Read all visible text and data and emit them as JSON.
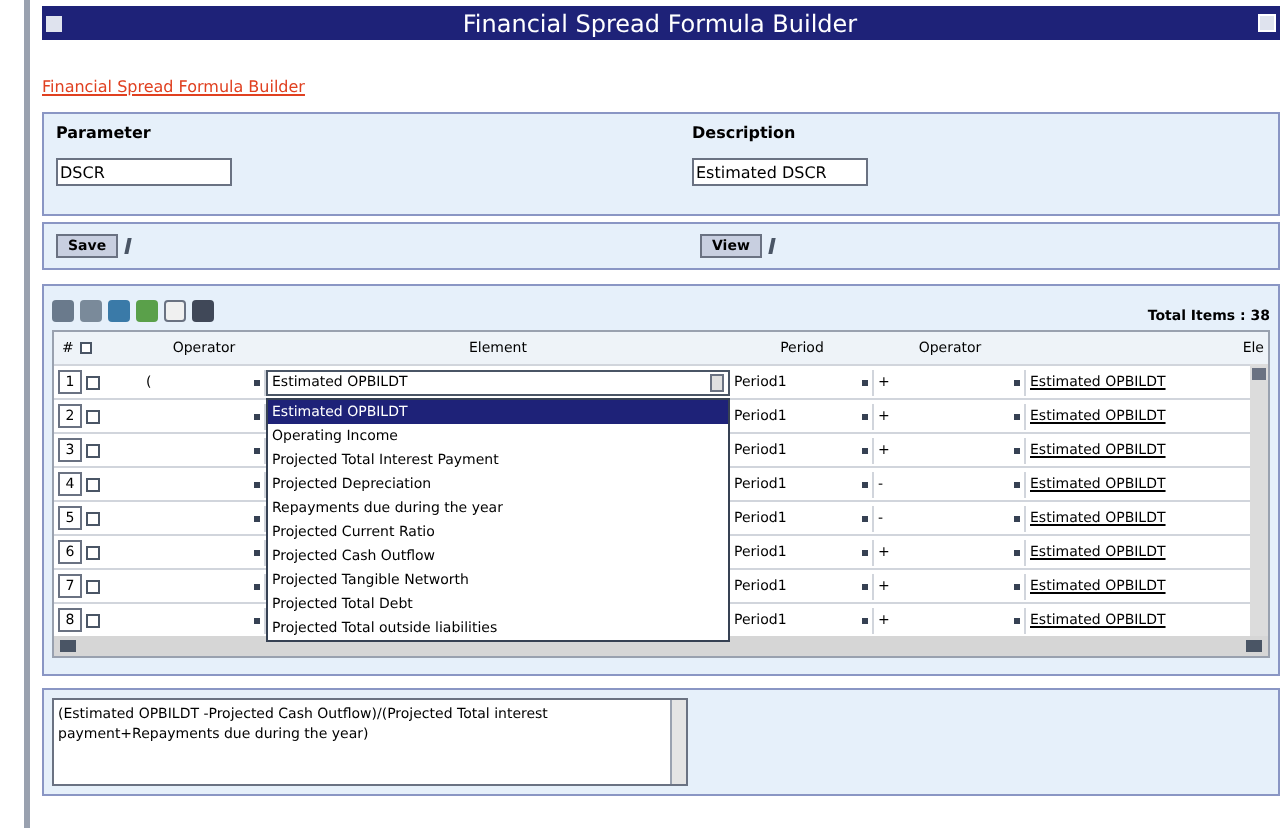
{
  "window": {
    "title": "Financial Spread Formula Builder"
  },
  "breadcrumb": "Financial Spread Formula Builder",
  "parameter": {
    "label": "Parameter",
    "value": "DSCR"
  },
  "description": {
    "label": "Description",
    "value": "Estimated DSCR"
  },
  "buttons": [
    {
      "label": "Save"
    },
    {
      "label": "View"
    }
  ],
  "grid": {
    "total": "Total Items : 38",
    "columns": [
      "#",
      "Operator",
      "Element",
      "Period",
      "Operator",
      "Ele"
    ],
    "select_all_checked": false,
    "rows": [
      {
        "number": "1",
        "checked": false,
        "operator": "(",
        "element": "Estimated OPBILDT",
        "period": "Period1",
        "operator_2": "+",
        "element_2": "Estimated OPBILDT"
      },
      {
        "number": "2",
        "checked": false,
        "period": "Period1",
        "operator_2": "+",
        "element_2": "Estimated OPBILDT"
      },
      {
        "number": "3",
        "checked": false,
        "period": "Period1",
        "operator_2": "+",
        "element_2": "Estimated OPBILDT"
      },
      {
        "number": "4",
        "checked": false,
        "period": "Period1",
        "operator_2": "-",
        "element_2": "Estimated OPBILDT"
      },
      {
        "number": "5",
        "checked": false,
        "period": "Period1",
        "operator_2": "-",
        "element_2": "Estimated OPBILDT"
      },
      {
        "number": "6",
        "checked": false,
        "period": "Period1",
        "operator_2": "+",
        "element_2": "Estimated OPBILDT"
      },
      {
        "number": "7",
        "checked": false,
        "period": "Period1",
        "operator_2": "+",
        "element_2": "Estimated OPBILDT"
      },
      {
        "number": "8",
        "checked": false,
        "period": "Period1",
        "operator_2": "+",
        "element_2": "Estimated OPBILDT"
      }
    ],
    "dropdown": [
      {
        "label": "Estimated OPBILDT",
        "selected": true
      },
      {
        "label": "Operating Income",
        "selected": false
      },
      {
        "label": "Projected Total Interest Payment",
        "selected": false
      },
      {
        "label": "Projected Depreciation",
        "selected": false
      },
      {
        "label": "Repayments due during the year",
        "selected": false
      },
      {
        "label": "Projected Current Ratio",
        "selected": false
      },
      {
        "label": "Projected Cash Outflow",
        "selected": false
      },
      {
        "label": "Projected Tangible Networth",
        "selected": false
      },
      {
        "label": "Projected Total Debt",
        "selected": false
      },
      {
        "label": "Projected Total outside liabilities",
        "selected": false
      }
    ]
  },
  "formula": "(Estimated OPBILDT -Projected Cash Outflow)/(Projected Total interest payment+Repayments due during the year)"
}
